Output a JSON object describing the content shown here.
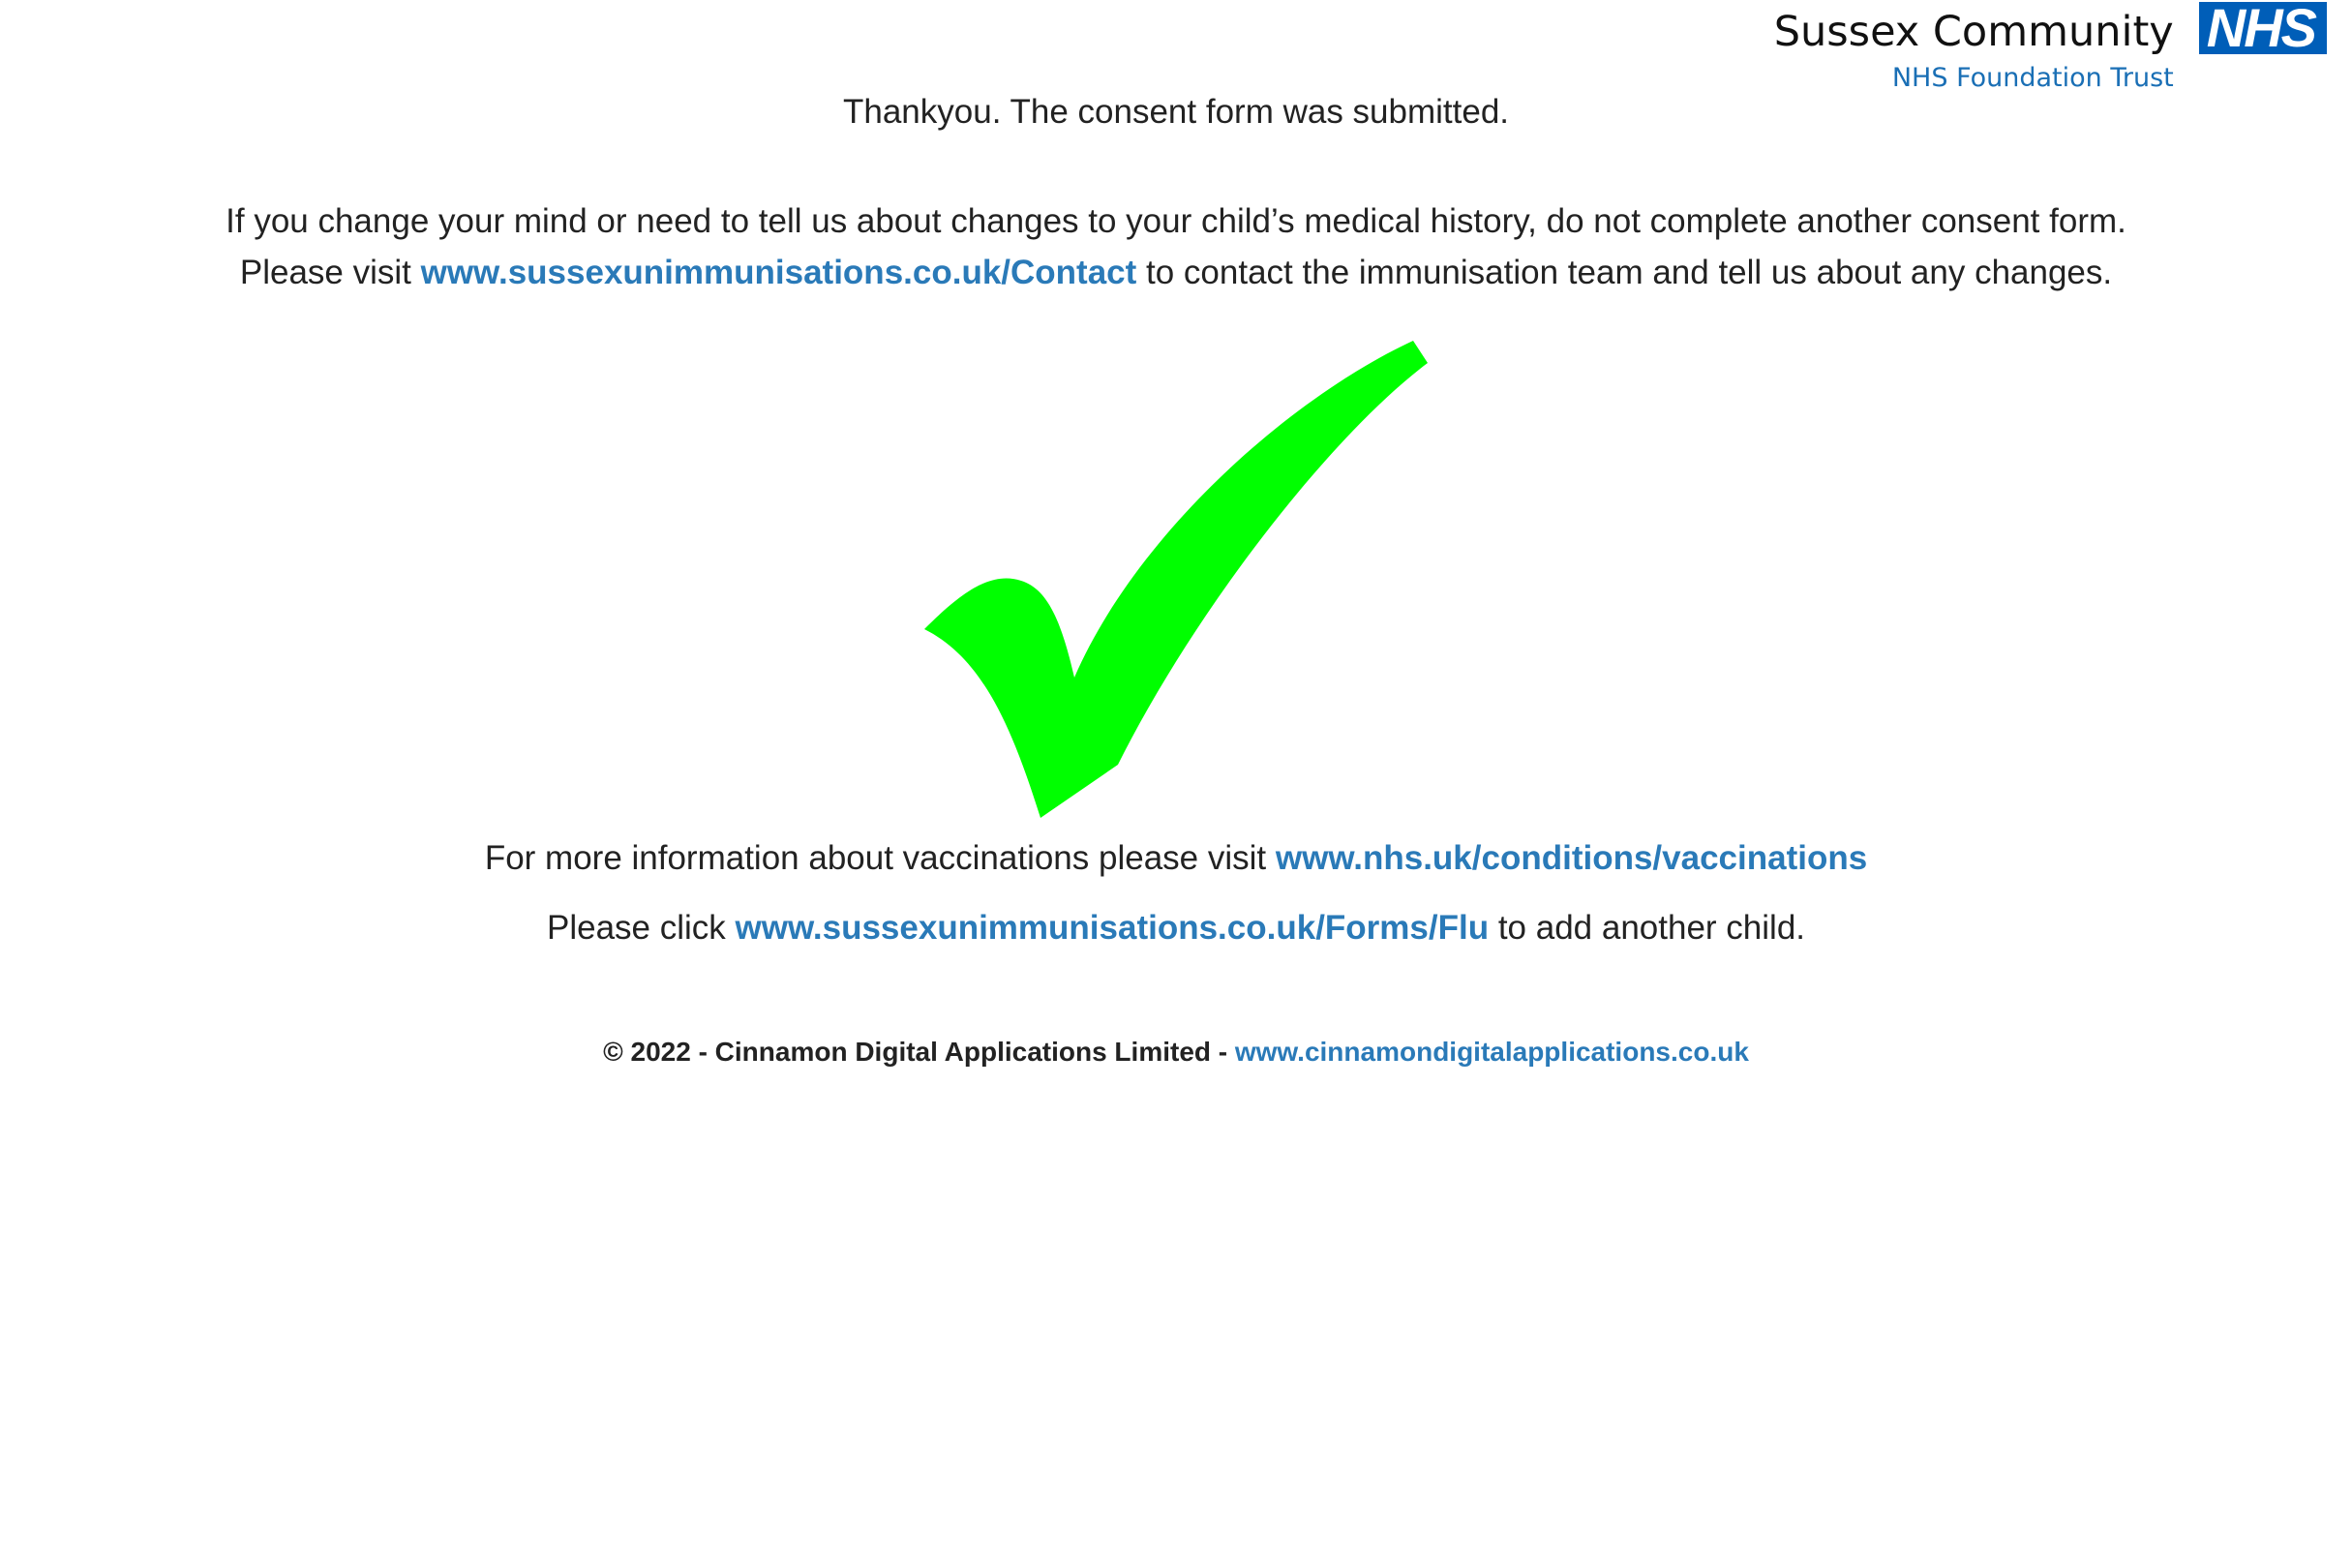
{
  "header": {
    "org_name": "Sussex Community",
    "org_subtitle": "NHS Foundation Trust",
    "nhs_logo": "NHS"
  },
  "confirmation": {
    "title": "Thankyou. The consent form was submitted.",
    "notice_line1": "If you change your mind or need to tell us about changes to your child’s medical history, do not complete another consent form.",
    "notice_line2_pre": "Please visit ",
    "contact_link": "www.sussexunimmunisations.co.uk/Contact",
    "notice_line2_post": " to contact the immunisation team and tell us about any changes.",
    "check_icon": "checkmark-icon",
    "check_color": "#00ff00"
  },
  "info": {
    "vacc_pre": "For more information about vaccinations please visit ",
    "vacc_link": "www.nhs.uk/conditions/vaccinations",
    "child_pre": "Please click ",
    "child_link": "www.sussexunimmunisations.co.uk/Forms/Flu",
    "child_post": " to add another child."
  },
  "footer": {
    "copyright": "© 2022 - Cinnamon Digital Applications Limited - ",
    "company_link": "www.cinnamondigitalapplications.co.uk"
  },
  "colors": {
    "link": "#2a7ab8",
    "nhs_blue": "#005eb8",
    "text": "#222222"
  }
}
